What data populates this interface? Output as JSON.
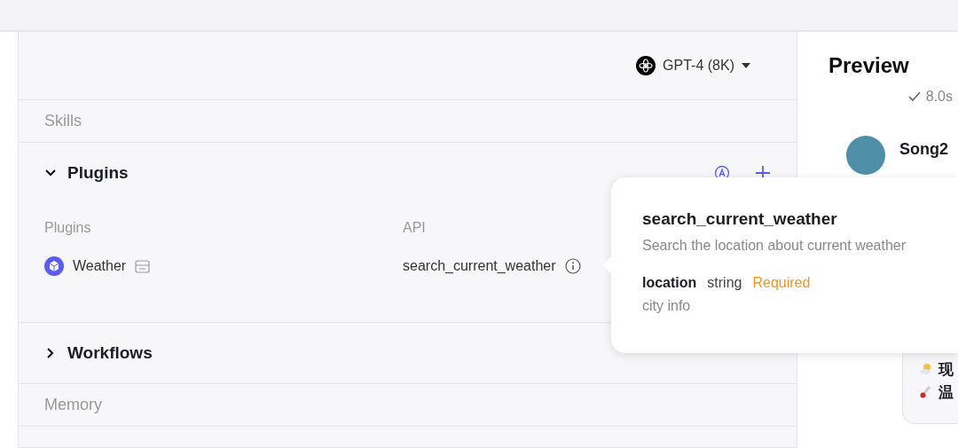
{
  "model_selector": {
    "label": "GPT-4 (8K)"
  },
  "skills_heading": "Skills",
  "plugins_section": {
    "title": "Plugins",
    "expanded": true,
    "columns": [
      "Plugins",
      "API"
    ],
    "rows": [
      {
        "plugin": "Weather",
        "api": "search_current_weather"
      }
    ]
  },
  "workflows_section": {
    "title": "Workflows",
    "expanded": false
  },
  "memory_heading": "Memory",
  "tooltip": {
    "title": "search_current_weather",
    "description": "Search the location about current weather",
    "params": [
      {
        "name": "location",
        "type": "string",
        "required_label": "Required",
        "description": "city info"
      }
    ]
  },
  "preview": {
    "title": "Preview",
    "status": "8.0s",
    "bot_name": "Song2",
    "message_lines": [
      "现",
      "温"
    ]
  }
}
